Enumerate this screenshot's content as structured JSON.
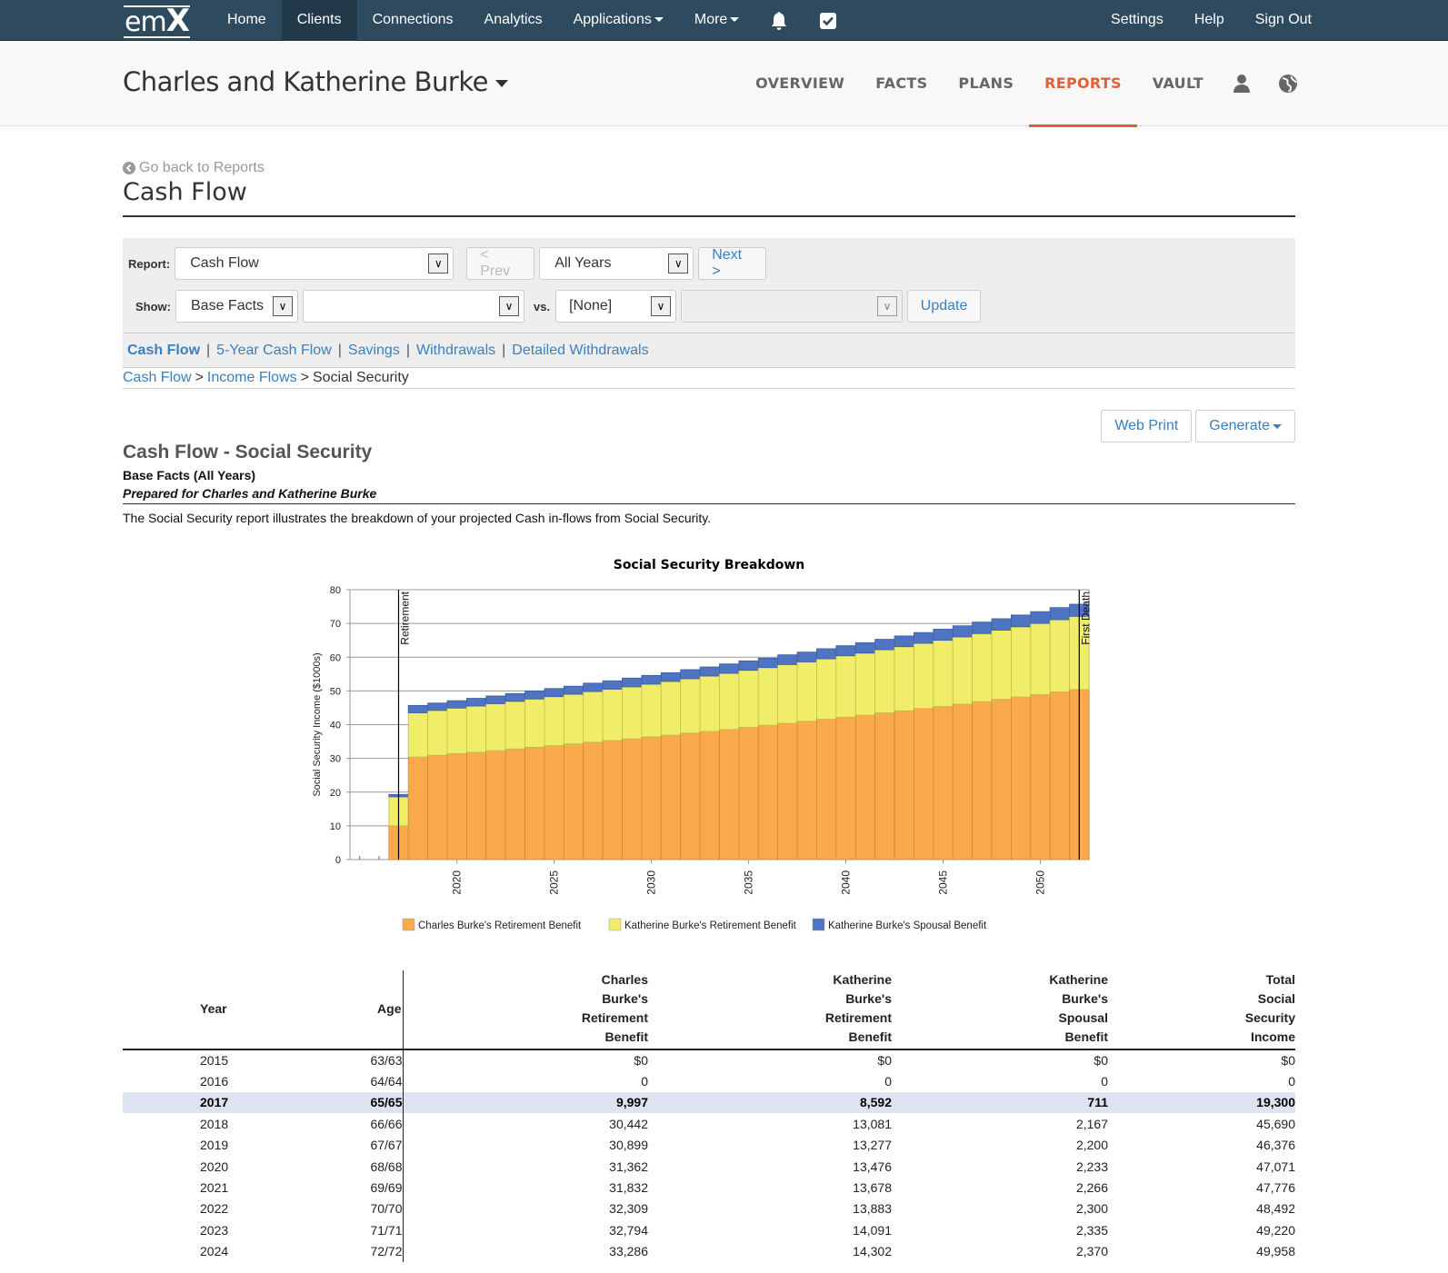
{
  "topnav": {
    "logo": "emX",
    "items": [
      {
        "label": "Home",
        "active": false
      },
      {
        "label": "Clients",
        "active": true
      },
      {
        "label": "Connections",
        "active": false
      },
      {
        "label": "Analytics",
        "active": false
      },
      {
        "label": "Applications",
        "active": false,
        "dropdown": true
      },
      {
        "label": "More",
        "active": false,
        "dropdown": true
      }
    ],
    "icons": [
      "bell-icon",
      "checkbox-icon"
    ],
    "right_items": [
      {
        "label": "Settings"
      },
      {
        "label": "Help"
      },
      {
        "label": "Sign Out"
      }
    ]
  },
  "client": {
    "name": "Charles and Katherine Burke",
    "tabs": [
      {
        "label": "OVERVIEW",
        "active": false
      },
      {
        "label": "FACTS",
        "active": false
      },
      {
        "label": "PLANS",
        "active": false
      },
      {
        "label": "REPORTS",
        "active": true
      },
      {
        "label": "VAULT",
        "active": false
      }
    ],
    "icons": [
      "user-icon",
      "globe-icon"
    ]
  },
  "page": {
    "back_link": "Go back to Reports",
    "title": "Cash Flow"
  },
  "controls": {
    "report_label": "Report:",
    "report_value": "Cash Flow",
    "prev_label": "< Prev",
    "years_value": "All Years",
    "next_label": "Next >",
    "show_label": "Show:",
    "show_value": "Base Facts",
    "show_second_value": "",
    "vs_label": "vs.",
    "vs_value": "[None]",
    "vs_second_value": "",
    "update_label": "Update"
  },
  "sublinks": [
    {
      "label": "Cash Flow",
      "current": true
    },
    {
      "label": "5-Year Cash Flow",
      "current": false
    },
    {
      "label": "Savings",
      "current": false
    },
    {
      "label": "Withdrawals",
      "current": false
    },
    {
      "label": "Detailed Withdrawals",
      "current": false
    }
  ],
  "breadcrumb": [
    {
      "label": "Cash Flow",
      "link": true
    },
    {
      "label": "Income Flows",
      "link": true
    },
    {
      "label": "Social Security",
      "link": false
    }
  ],
  "actions": {
    "web_print": "Web Print",
    "generate": "Generate"
  },
  "report": {
    "title": "Cash Flow - Social Security",
    "subtitle": "Base Facts (All Years)",
    "prepared_for": "Prepared for Charles and Katherine Burke",
    "description": "The Social Security report illustrates the breakdown of your projected Cash in-flows from Social Security."
  },
  "chart_data": {
    "type": "bar",
    "stacked": true,
    "title": "Social Security Breakdown",
    "xlabel": "",
    "ylabel": "Social Security Income ($1000s)",
    "ylim": [
      0,
      80
    ],
    "yticks": [
      0,
      10,
      20,
      30,
      40,
      50,
      60,
      70,
      80
    ],
    "xticks": [
      2020,
      2025,
      2030,
      2035,
      2040,
      2045,
      2050
    ],
    "grid": true,
    "legend_position": "bottom",
    "categories": [
      2015,
      2016,
      2017,
      2018,
      2019,
      2020,
      2021,
      2022,
      2023,
      2024,
      2025,
      2026,
      2027,
      2028,
      2029,
      2030,
      2031,
      2032,
      2033,
      2034,
      2035,
      2036,
      2037,
      2038,
      2039,
      2040,
      2041,
      2042,
      2043,
      2044,
      2045,
      2046,
      2047,
      2048,
      2049,
      2050,
      2051,
      2052
    ],
    "series": [
      {
        "name": "Charles Burke's Retirement Benefit",
        "color": "#fbaa4b",
        "values": [
          0,
          0,
          10.0,
          30.4,
          30.9,
          31.4,
          31.8,
          32.3,
          32.8,
          33.3,
          33.8,
          34.3,
          34.8,
          35.3,
          35.8,
          36.4,
          36.9,
          37.5,
          38.0,
          38.6,
          39.2,
          39.8,
          40.4,
          41.0,
          41.6,
          42.2,
          42.8,
          43.5,
          44.1,
          44.8,
          45.4,
          46.1,
          46.8,
          47.5,
          48.2,
          48.9,
          49.7,
          50.4
        ]
      },
      {
        "name": "Katherine Burke's Retirement Benefit",
        "color": "#f0ee68",
        "values": [
          0,
          0,
          8.6,
          13.1,
          13.3,
          13.5,
          13.7,
          13.9,
          14.1,
          14.3,
          14.5,
          14.7,
          15.0,
          15.2,
          15.4,
          15.6,
          15.9,
          16.1,
          16.4,
          16.6,
          16.9,
          17.1,
          17.4,
          17.6,
          17.9,
          18.2,
          18.4,
          18.7,
          19.0,
          19.3,
          19.6,
          19.9,
          20.2,
          20.5,
          20.8,
          21.1,
          21.4,
          21.7
        ]
      },
      {
        "name": "Katherine Burke's Spousal Benefit",
        "color": "#4f74c2",
        "values": [
          0,
          0,
          0.7,
          2.2,
          2.2,
          2.2,
          2.3,
          2.3,
          2.3,
          2.4,
          2.4,
          2.4,
          2.5,
          2.5,
          2.6,
          2.6,
          2.6,
          2.7,
          2.7,
          2.8,
          2.8,
          2.8,
          2.9,
          2.9,
          3.0,
          3.0,
          3.1,
          3.1,
          3.2,
          3.2,
          3.3,
          3.3,
          3.4,
          3.4,
          3.5,
          3.5,
          3.6,
          3.6
        ]
      }
    ],
    "annotations": [
      {
        "label": "Retirement",
        "x": 2017.5
      },
      {
        "label": "First Death",
        "x": 2052.5
      }
    ]
  },
  "table": {
    "columns": [
      "Year",
      "Age",
      "Charles Burke's Retirement Benefit",
      "Katherine Burke's Retirement Benefit",
      "Katherine Burke's Spousal Benefit",
      "Total Social Security Income"
    ],
    "column_lines": [
      [
        "Year"
      ],
      [
        "Age"
      ],
      [
        "Charles",
        "Burke's",
        "Retirement",
        "Benefit"
      ],
      [
        "Katherine",
        "Burke's",
        "Retirement",
        "Benefit"
      ],
      [
        "Katherine",
        "Burke's",
        "Spousal",
        "Benefit"
      ],
      [
        "Total",
        "Social",
        "Security",
        "Income"
      ]
    ],
    "rows": [
      {
        "year": "2015",
        "age": "63/63",
        "charles": "$0",
        "katherine": "$0",
        "spousal": "$0",
        "total": "$0",
        "highlight": false
      },
      {
        "year": "2016",
        "age": "64/64",
        "charles": "0",
        "katherine": "0",
        "spousal": "0",
        "total": "0",
        "highlight": false
      },
      {
        "year": "2017",
        "age": "65/65",
        "charles": "9,997",
        "katherine": "8,592",
        "spousal": "711",
        "total": "19,300",
        "highlight": true
      },
      {
        "year": "2018",
        "age": "66/66",
        "charles": "30,442",
        "katherine": "13,081",
        "spousal": "2,167",
        "total": "45,690",
        "highlight": false
      },
      {
        "year": "2019",
        "age": "67/67",
        "charles": "30,899",
        "katherine": "13,277",
        "spousal": "2,200",
        "total": "46,376",
        "highlight": false
      },
      {
        "year": "2020",
        "age": "68/68",
        "charles": "31,362",
        "katherine": "13,476",
        "spousal": "2,233",
        "total": "47,071",
        "highlight": false
      },
      {
        "year": "2021",
        "age": "69/69",
        "charles": "31,832",
        "katherine": "13,678",
        "spousal": "2,266",
        "total": "47,776",
        "highlight": false
      },
      {
        "year": "2022",
        "age": "70/70",
        "charles": "32,309",
        "katherine": "13,883",
        "spousal": "2,300",
        "total": "48,492",
        "highlight": false
      },
      {
        "year": "2023",
        "age": "71/71",
        "charles": "32,794",
        "katherine": "14,091",
        "spousal": "2,335",
        "total": "49,220",
        "highlight": false
      },
      {
        "year": "2024",
        "age": "72/72",
        "charles": "33,286",
        "katherine": "14,302",
        "spousal": "2,370",
        "total": "49,958",
        "highlight": false
      }
    ]
  }
}
